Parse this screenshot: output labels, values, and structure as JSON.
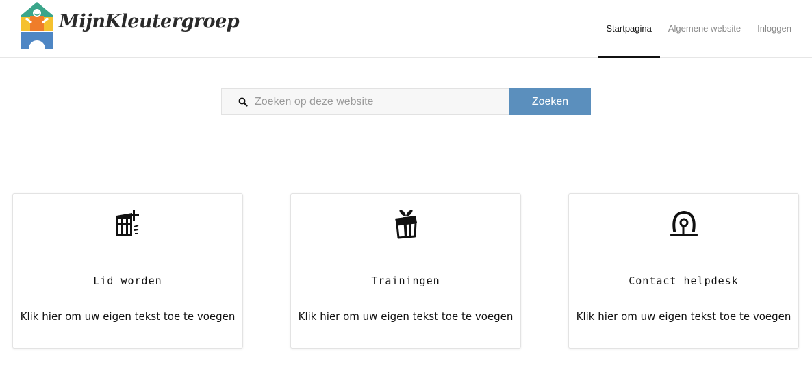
{
  "logo": {
    "text": "MijnKleutergroep",
    "colors": [
      "#3aa58a",
      "#f5c12e",
      "#4e86c4",
      "#ef7d2a"
    ]
  },
  "nav": {
    "items": [
      {
        "label": "Startpagina",
        "active": true
      },
      {
        "label": "Algemene website",
        "active": false
      },
      {
        "label": "Inloggen",
        "active": false
      }
    ]
  },
  "search": {
    "placeholder": "Zoeken op deze website",
    "value": "",
    "button_label": "Zoeken",
    "icon": "search-icon",
    "button_color": "#5b8fbd"
  },
  "cards": [
    {
      "icon": "building-icon",
      "title": "Lid worden",
      "text": "Klik hier om uw eigen tekst toe te voegen"
    },
    {
      "icon": "gift-icon",
      "title": "Trainingen",
      "text": "Klik hier om uw eigen tekst toe te voegen"
    },
    {
      "icon": "headset-icon",
      "title": "Contact helpdesk",
      "text": "Klik hier om uw eigen tekst toe te voegen"
    }
  ]
}
